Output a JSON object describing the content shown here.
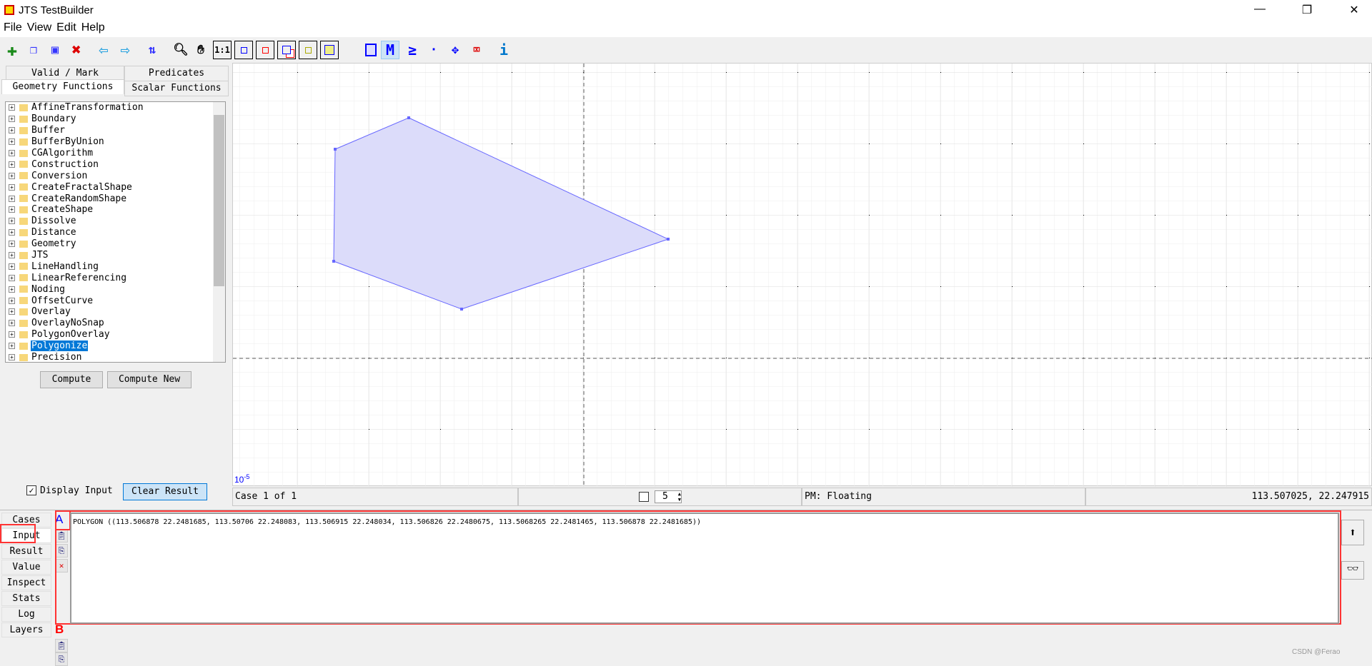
{
  "window": {
    "title": "JTS TestBuilder",
    "minimize": "—",
    "maximize": "❐",
    "close": "✕"
  },
  "menu": [
    "File",
    "View",
    "Edit",
    "Help"
  ],
  "toolbar": [
    "add-case",
    "copy-case",
    "copy-all",
    "delete-case",
    "previous",
    "next",
    "exchange-geometries",
    "zoom",
    "pan",
    "1:1",
    "zoom-to-a",
    "zoom-to-b",
    "zoom-to-input",
    "zoom-to-result",
    "zoom-to-full",
    "draw-polygon",
    "draw-linestring",
    "draw-lines",
    "draw-point",
    "edit-vertex",
    "delete-vertex",
    "info"
  ],
  "left_tabs": {
    "valid_mark": "Valid / Mark",
    "predicates": "Predicates",
    "geometry_functions": "Geometry Functions",
    "scalar_functions": "Scalar Functions"
  },
  "tree": [
    "AffineTransformation",
    "Boundary",
    "Buffer",
    "BufferByUnion",
    "CGAlgorithm",
    "Construction",
    "Conversion",
    "CreateFractalShape",
    "CreateRandomShape",
    "CreateShape",
    "Dissolve",
    "Distance",
    "Geometry",
    "JTS",
    "LineHandling",
    "LinearReferencing",
    "Noding",
    "OffsetCurve",
    "Overlay",
    "OverlayNoSnap",
    "PolygonOverlay",
    "Polygonize",
    "Precision"
  ],
  "tree_selected": "Polygonize",
  "buttons": {
    "compute": "Compute",
    "compute_new": "Compute New",
    "display_input": "Display Input",
    "clear_result": "Clear Result"
  },
  "display_input_checked": true,
  "canvas": {
    "scale_label": "10",
    "scale_exp": "-5",
    "polygon_color": "#6666ff",
    "polygon_fill": "#dcdcfa"
  },
  "status": {
    "case": "Case 1 of 1",
    "spinner": "5",
    "precision_model": "PM: Floating",
    "coords": "113.507025, 22.247915"
  },
  "side_tabs": [
    "Cases",
    "Input",
    "Result",
    "Value",
    "Inspect",
    "Stats",
    "Log",
    "Layers"
  ],
  "active_side_tab": "Input",
  "geom_a_label": "A",
  "geom_b_label": "B",
  "wkt_a": "POLYGON ((113.506878 22.2481685, 113.50706 22.248083, 113.506915 22.248034, 113.506826 22.2480675, 113.5068265 22.2481465, 113.506878 22.2481685))",
  "watermark": "CSDN @Ferao"
}
